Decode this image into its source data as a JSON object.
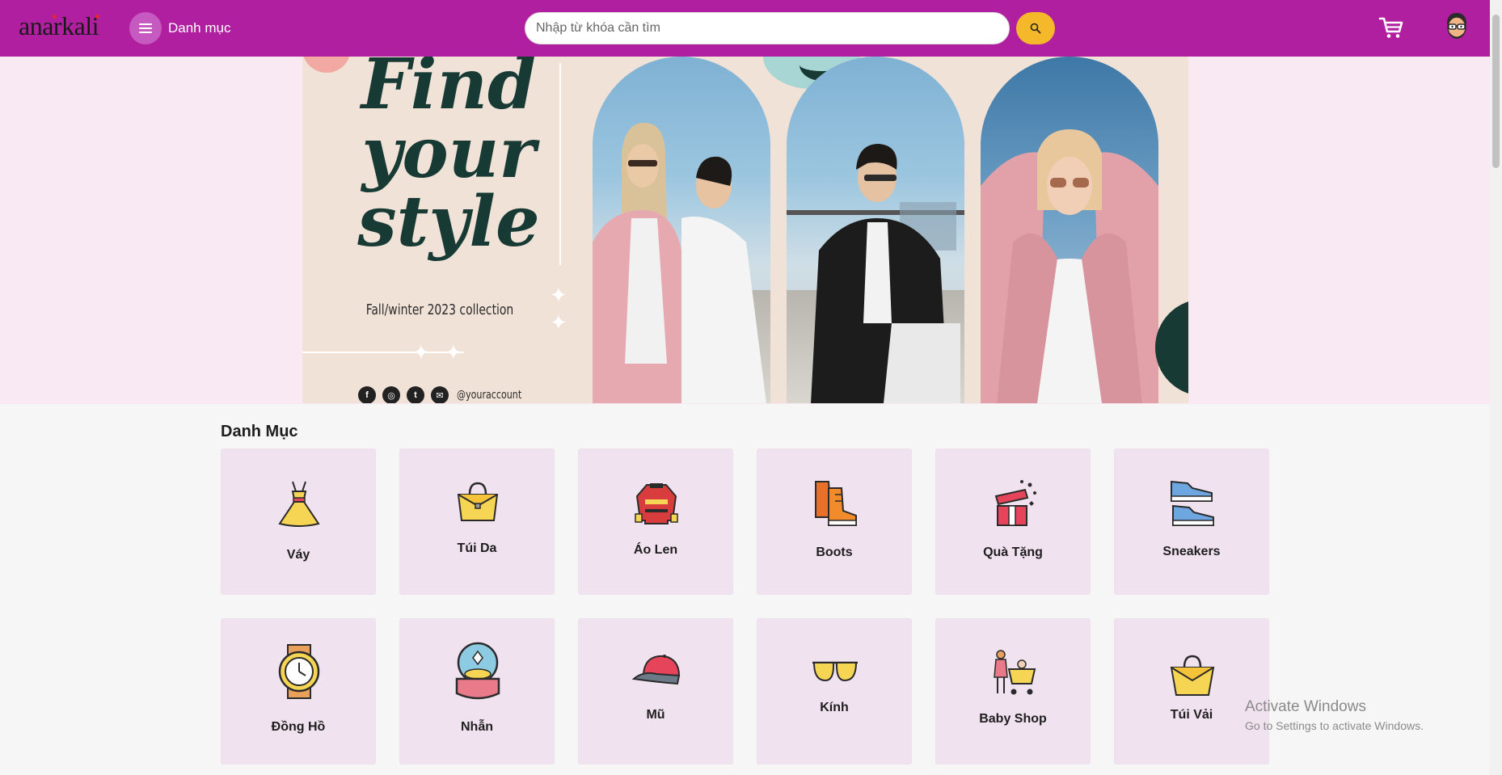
{
  "header": {
    "logo": "anarkali",
    "menu_label": "Danh mục",
    "search_placeholder": "Nhập từ khóa cần tìm"
  },
  "banner": {
    "title_line1": "Find",
    "title_line2": "your",
    "title_line3": "style",
    "subtitle": "Fall/winter 2023 collection",
    "handle": "@youraccount",
    "socials": [
      "facebook-icon",
      "instagram-icon",
      "twitter-icon",
      "email-icon"
    ]
  },
  "categories": {
    "title": "Danh Mục",
    "items": [
      {
        "label": "Váy",
        "icon": "dress-icon"
      },
      {
        "label": "Túi Da",
        "icon": "handbag-icon"
      },
      {
        "label": "Áo Len",
        "icon": "sweater-icon"
      },
      {
        "label": "Boots",
        "icon": "boots-icon"
      },
      {
        "label": "Quà Tặng",
        "icon": "gift-icon"
      },
      {
        "label": "Sneakers",
        "icon": "sneakers-icon"
      },
      {
        "label": "Đồng Hồ",
        "icon": "watch-icon"
      },
      {
        "label": "Nhẫn",
        "icon": "ring-icon"
      },
      {
        "label": "Mũ",
        "icon": "cap-icon"
      },
      {
        "label": "Kính",
        "icon": "sunglasses-icon"
      },
      {
        "label": "Baby Shop",
        "icon": "baby-shop-icon"
      },
      {
        "label": "Túi Vải",
        "icon": "tote-bag-icon"
      }
    ]
  },
  "watermark": {
    "line1": "Activate Windows",
    "line2": "Go to Settings to activate Windows."
  }
}
